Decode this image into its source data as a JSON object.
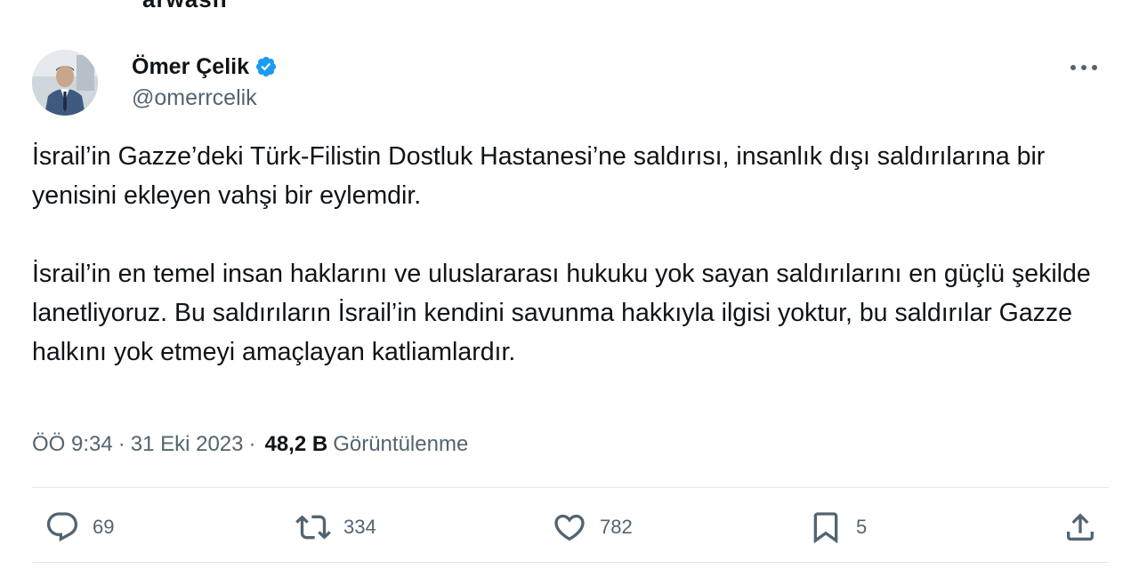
{
  "top_fragment": "arwasn",
  "author": {
    "display_name": "Ömer Çelik",
    "handle": "@omerrcelik",
    "verified": true,
    "avatar_icon": "person-avatar-icon"
  },
  "menu": {
    "more_icon": "ellipsis-icon"
  },
  "tweet": {
    "paragraphs": [
      "İsrail’in Gazze’deki Türk-Filistin Dostluk Hastanesi’ne saldırısı, insanlık dışı saldırılarına bir yenisini ekleyen vahşi bir eylemdir.",
      "İsrail’in en temel insan haklarını ve uluslararası hukuku yok sayan saldırılarını en güçlü şekilde lanetliyoruz. Bu saldırıların İsrail’in kendini savunma hakkıyla ilgisi yoktur, bu saldırılar Gazze halkını yok etmeyi amaçlayan katliamlardır."
    ]
  },
  "meta": {
    "time": "ÖÖ 9:34",
    "separator": "·",
    "date": "31 Eki 2023",
    "views_count": "48,2 B",
    "views_label": "Görüntülenme"
  },
  "actions": {
    "reply": {
      "icon": "reply-icon",
      "count": "69"
    },
    "retweet": {
      "icon": "retweet-icon",
      "count": "334"
    },
    "like": {
      "icon": "heart-icon",
      "count": "782"
    },
    "bookmark": {
      "icon": "bookmark-icon",
      "count": "5"
    },
    "share": {
      "icon": "share-icon"
    }
  },
  "colors": {
    "text_primary": "#0f1419",
    "text_secondary": "#536471",
    "verified_blue": "#1d9bf0",
    "divider": "#e1e5e9"
  }
}
